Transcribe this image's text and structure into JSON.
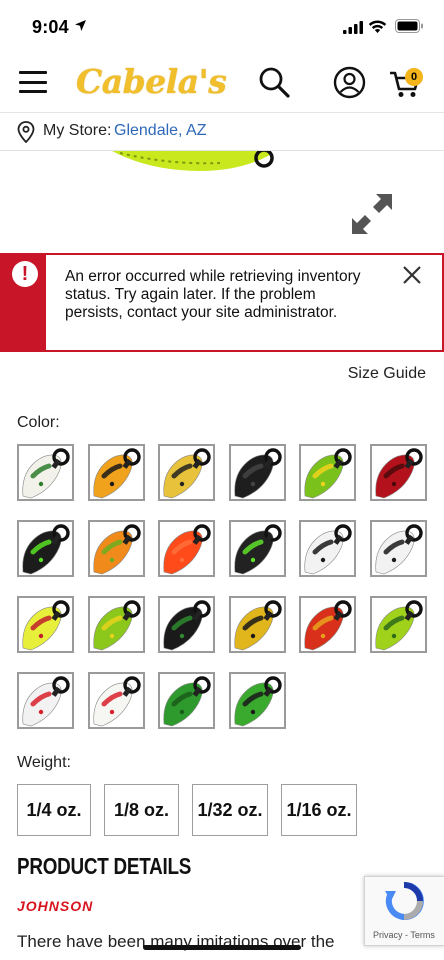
{
  "status_bar": {
    "time": "9:04"
  },
  "header": {
    "logo": "Cabela's",
    "cart_count": "0"
  },
  "store": {
    "label": "My Store:",
    "name": "Glendale, AZ"
  },
  "error": {
    "message": "An error occurred while retrieving inventory status. Try again later. If the problem persists, contact your site administrator."
  },
  "size_guide": "Size Guide",
  "color": {
    "label": "Color:",
    "swatches": [
      {
        "body": "#f2f2ea",
        "accent": "#2e7d2e"
      },
      {
        "body": "#f0a21c",
        "accent": "#1a1a1a"
      },
      {
        "body": "#e8c23a",
        "accent": "#222222"
      },
      {
        "body": "#1e1e1e",
        "accent": "#444444"
      },
      {
        "body": "#7ac21b",
        "accent": "#f2d21c"
      },
      {
        "body": "#b3121c",
        "accent": "#4a0a0a"
      },
      {
        "body": "#1c1c1c",
        "accent": "#58e022"
      },
      {
        "body": "#f08a1a",
        "accent": "#6cae22"
      },
      {
        "body": "#ff4a1a",
        "accent": "#ff6e3a"
      },
      {
        "body": "#222222",
        "accent": "#5fe02a"
      },
      {
        "body": "#f2f2f2",
        "accent": "#1a1a1a"
      },
      {
        "body": "#f2f2f2",
        "accent": "#1a1a1a"
      },
      {
        "body": "#e8ef3a",
        "accent": "#c0202a"
      },
      {
        "body": "#8cc81b",
        "accent": "#e8d21c"
      },
      {
        "body": "#1a1a1a",
        "accent": "#2e8a2e"
      },
      {
        "body": "#e0b61c",
        "accent": "#1a1a1a"
      },
      {
        "body": "#d8301a",
        "accent": "#e8a21c"
      },
      {
        "body": "#a0d21c",
        "accent": "#2e6a1a"
      },
      {
        "body": "#f2f2f2",
        "accent": "#d8202a"
      },
      {
        "body": "#f6f6f2",
        "accent": "#d8202a"
      },
      {
        "body": "#2e9a2e",
        "accent": "#1a5a1a"
      },
      {
        "body": "#3aaa2e",
        "accent": "#1a1a1a"
      }
    ]
  },
  "weight": {
    "label": "Weight:",
    "options": [
      "1/4 oz.",
      "1/8 oz.",
      "1/32 oz.",
      "1/16 oz."
    ]
  },
  "details": {
    "title": "PRODUCT DETAILS",
    "brand": "JOHNSON",
    "description": "There have been many imitations over the"
  },
  "recaptcha": {
    "terms": "Privacy - Terms"
  },
  "colors": {
    "brand_yellow": "#f1be2c",
    "error_red": "#c81528",
    "link_blue": "#2e69b8"
  }
}
